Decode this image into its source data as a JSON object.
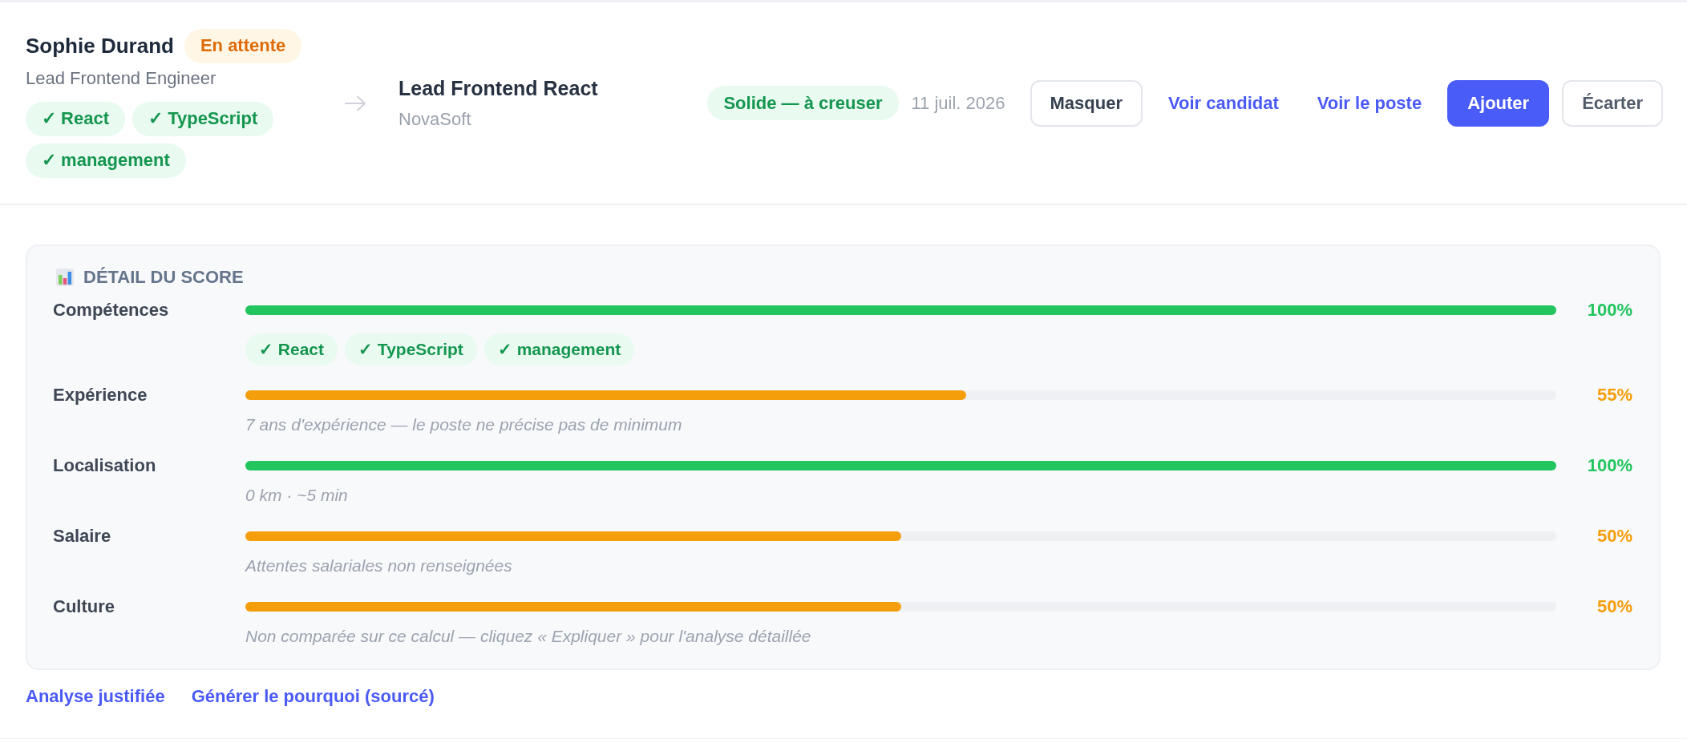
{
  "candidate": {
    "name": "Sophie Durand",
    "status": {
      "label": "En attente",
      "kind": "pending"
    },
    "title": "Lead Frontend Engineer",
    "skills": [
      "✓ React",
      "✓ TypeScript",
      "✓ management"
    ]
  },
  "job": {
    "title": "Lead Frontend React",
    "company": "NovaSoft"
  },
  "match": {
    "label": "Solide — à creuser",
    "kind": "good",
    "date": "11 juil. 2026"
  },
  "actions": [
    {
      "label": "Masquer",
      "kind": "secondary"
    },
    {
      "label": "Voir candidat",
      "kind": "link"
    },
    {
      "label": "Voir le poste",
      "kind": "link"
    },
    {
      "label": "Ajouter",
      "kind": "primary"
    },
    {
      "label": "Écarter",
      "kind": "dismiss"
    }
  ],
  "score_detail": {
    "title": "DÉTAIL DU SCORE",
    "criteria": [
      {
        "name": "Compétences",
        "level": 1,
        "reading": "100%",
        "color": "#22c55e",
        "skills": [
          "✓ React",
          "✓ TypeScript",
          "✓ management"
        ]
      },
      {
        "name": "Expérience",
        "level": 0.55,
        "reading": "55%",
        "color": "#f59e0b",
        "note": "7 ans d'expérience — le poste ne précise pas de minimum"
      },
      {
        "name": "Localisation",
        "level": 1,
        "reading": "100%",
        "color": "#22c55e",
        "note": "0 km · ~5 min"
      },
      {
        "name": "Salaire",
        "level": 0.5,
        "reading": "50%",
        "color": "#f59e0b",
        "note": "Attentes salariales non renseignées"
      },
      {
        "name": "Culture",
        "level": 0.5,
        "reading": "50%",
        "color": "#f59e0b",
        "note": "Non comparée sur ce calcul — cliquez « Expliquer » pour l'analyse détaillée"
      }
    ]
  },
  "links": [
    "Analyse justifiée",
    "Générer le pourquoi (sourcé)"
  ]
}
